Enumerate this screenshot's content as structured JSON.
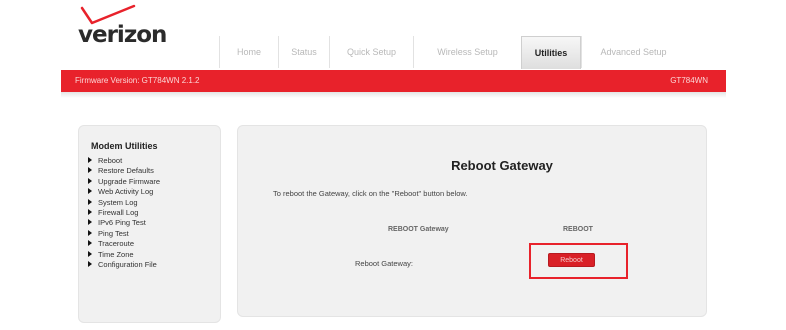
{
  "brand": {
    "logo_text": "verizon",
    "accent": "#e8222b"
  },
  "nav": {
    "tabs": [
      {
        "label": "Home",
        "active": false
      },
      {
        "label": "Status",
        "active": false
      },
      {
        "label": "Quick Setup",
        "active": false
      },
      {
        "label": "Wireless Setup",
        "active": false
      },
      {
        "label": "Utilities",
        "active": true
      },
      {
        "label": "Advanced Setup",
        "active": false
      }
    ]
  },
  "status_bar": {
    "firmware": "Firmware Version: GT784WN 2.1.2",
    "model": "GT784WN"
  },
  "sidebar": {
    "title": "Modem Utilities",
    "items": [
      "Reboot",
      "Restore Defaults",
      "Upgrade Firmware",
      "Web Activity Log",
      "System Log",
      "Firewall Log",
      "IPv6 Ping Test",
      "Ping Test",
      "Traceroute",
      "Time Zone",
      "Configuration File"
    ]
  },
  "main": {
    "title": "Reboot Gateway",
    "instructions": "To reboot the Gateway, click on the \"Reboot\" button below.",
    "table": {
      "col1": "REBOOT Gateway",
      "col2": "REBOOT",
      "row_label": "Reboot Gateway:",
      "button_label": "Reboot"
    }
  }
}
